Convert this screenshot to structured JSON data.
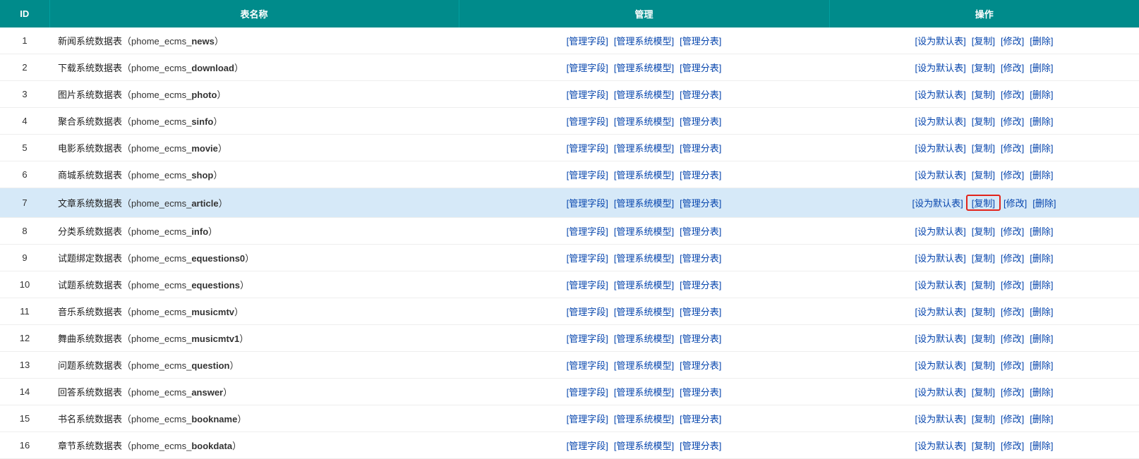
{
  "headers": {
    "id": "ID",
    "name": "表名称",
    "manage": "管理",
    "action": "操作"
  },
  "manage_links": {
    "fields": "[管理字段]",
    "model": "[管理系统模型]",
    "sub": "[管理分表]"
  },
  "action_links": {
    "set_default": "[设为默认表]",
    "copy": "[复制]",
    "edit": "[修改]",
    "delete": "[删除]"
  },
  "rows": [
    {
      "id": "1",
      "label": "新闻系统数据表",
      "prefix": "phome_ecms_",
      "suffix": "news",
      "highlight": false
    },
    {
      "id": "2",
      "label": "下载系统数据表",
      "prefix": "phome_ecms_",
      "suffix": "download",
      "highlight": false
    },
    {
      "id": "3",
      "label": "图片系统数据表",
      "prefix": "phome_ecms_",
      "suffix": "photo",
      "highlight": false
    },
    {
      "id": "4",
      "label": "聚合系统数据表",
      "prefix": "phome_ecms_",
      "suffix": "sinfo",
      "highlight": false
    },
    {
      "id": "5",
      "label": "电影系统数据表",
      "prefix": "phome_ecms_",
      "suffix": "movie",
      "highlight": false
    },
    {
      "id": "6",
      "label": "商城系统数据表",
      "prefix": "phome_ecms_",
      "suffix": "shop",
      "highlight": false
    },
    {
      "id": "7",
      "label": "文章系统数据表",
      "prefix": "phome_ecms_",
      "suffix": "article",
      "highlight": true,
      "highlight_copy": true
    },
    {
      "id": "8",
      "label": "分类系统数据表",
      "prefix": "phome_ecms_",
      "suffix": "info",
      "highlight": false
    },
    {
      "id": "9",
      "label": "试题绑定数据表",
      "prefix": "phome_ecms_",
      "suffix": "equestions0",
      "highlight": false
    },
    {
      "id": "10",
      "label": "试题系统数据表",
      "prefix": "phome_ecms_",
      "suffix": "equestions",
      "highlight": false
    },
    {
      "id": "11",
      "label": "音乐系统数据表",
      "prefix": "phome_ecms_",
      "suffix": "musicmtv",
      "highlight": false
    },
    {
      "id": "12",
      "label": "舞曲系统数据表",
      "prefix": "phome_ecms_",
      "suffix": "musicmtv1",
      "highlight": false
    },
    {
      "id": "13",
      "label": "问题系统数据表",
      "prefix": "phome_ecms_",
      "suffix": "question",
      "highlight": false
    },
    {
      "id": "14",
      "label": "回答系统数据表",
      "prefix": "phome_ecms_",
      "suffix": "answer",
      "highlight": false
    },
    {
      "id": "15",
      "label": "书名系统数据表",
      "prefix": "phome_ecms_",
      "suffix": "bookname",
      "highlight": false
    },
    {
      "id": "16",
      "label": "章节系统数据表",
      "prefix": "phome_ecms_",
      "suffix": "bookdata",
      "highlight": false
    }
  ]
}
